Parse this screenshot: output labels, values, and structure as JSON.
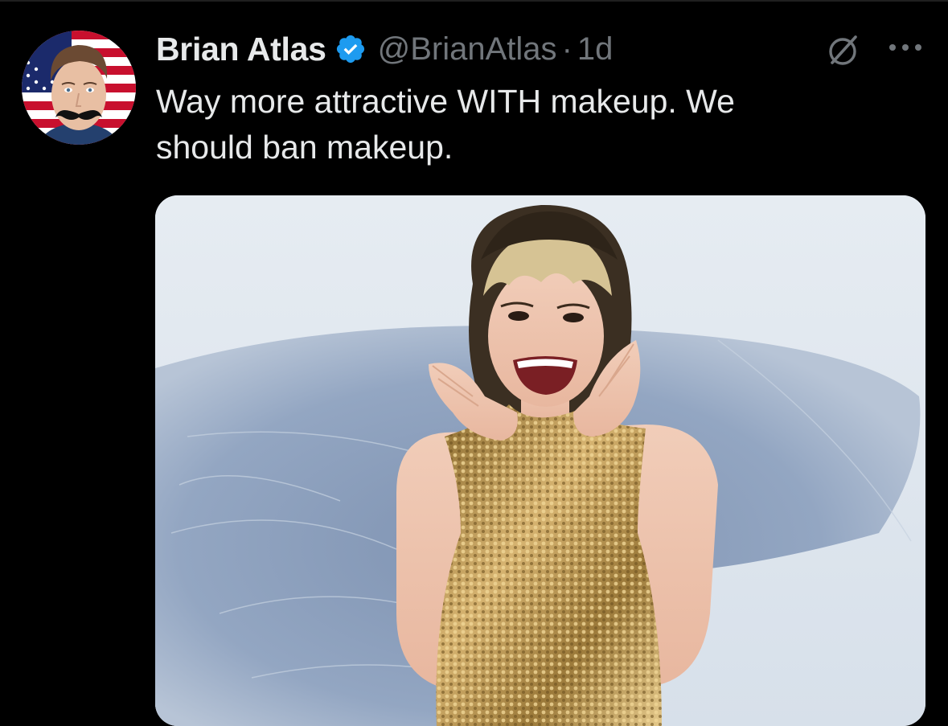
{
  "tweet": {
    "author": {
      "display_name": "Brian Atlas",
      "handle": "@BrianAtlas",
      "verified": true,
      "avatar_icon": "profile-avatar"
    },
    "timestamp": "1d",
    "separator": "·",
    "text": "Way more attractive WITH makeup. We\nshould ban makeup.",
    "actions": {
      "grok_icon": "grok-icon",
      "more_icon": "more-icon"
    },
    "media": {
      "type": "photo"
    }
  },
  "colors": {
    "background": "#000000",
    "primary_text": "#e7e9ea",
    "secondary_text": "#71767b",
    "verified_blue": "#1d9bf0"
  }
}
